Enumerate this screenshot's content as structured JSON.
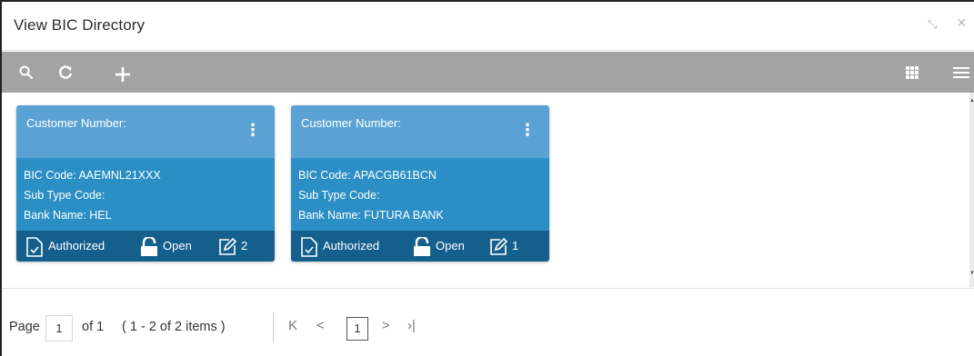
{
  "window": {
    "title": "View BIC Directory",
    "minimize_glyph": "⤡",
    "close_glyph": "×"
  },
  "toolbar": {
    "search_icon": "search-icon",
    "refresh_icon": "refresh-icon",
    "add_icon": "plus-icon",
    "grid_view_icon": "grid-icon",
    "list_view_icon": "list-icon"
  },
  "cards": [
    {
      "customer_number_label": "Customer Number:",
      "bic_code": "BIC Code:  AAEMNL21XXX",
      "sub_type_code": "Sub Type Code:",
      "bank_name": "Bank Name:  HEL",
      "status": "Authorized",
      "lock_status": "Open",
      "mod_no": "2"
    },
    {
      "customer_number_label": "Customer Number:",
      "bic_code": "BIC Code:  APACGB61BCN",
      "sub_type_code": "Sub Type Code:",
      "bank_name": "Bank Name:  FUTURA BANK",
      "status": "Authorized",
      "lock_status": "Open",
      "mod_no": "1"
    }
  ],
  "pagination": {
    "page_label": "Page",
    "page_input_value": "1",
    "of_label": "of 1",
    "items_label": "( 1 - 2 of 2 items )",
    "first_glyph": "K",
    "prev_glyph": "<",
    "current_page": "1",
    "next_glyph": ">",
    "last_glyph": "›|"
  },
  "colors": {
    "card_header": "#5aa2d3",
    "card_body": "#2b8fc6",
    "card_footer": "#155f8d",
    "toolbar": "#a3a3a3"
  }
}
